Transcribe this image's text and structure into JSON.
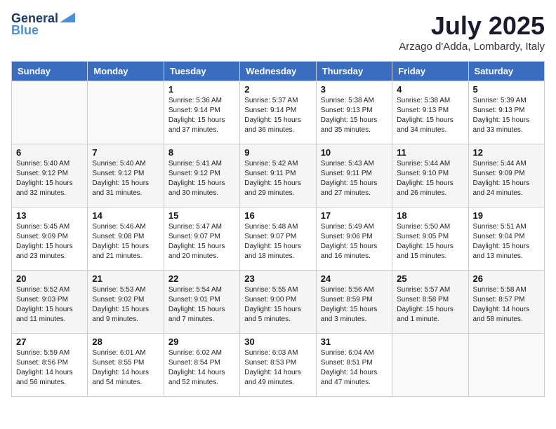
{
  "header": {
    "logo_line1": "General",
    "logo_line2": "Blue",
    "month": "July 2025",
    "location": "Arzago d'Adda, Lombardy, Italy"
  },
  "weekdays": [
    "Sunday",
    "Monday",
    "Tuesday",
    "Wednesday",
    "Thursday",
    "Friday",
    "Saturday"
  ],
  "weeks": [
    [
      {
        "day": "",
        "info": ""
      },
      {
        "day": "",
        "info": ""
      },
      {
        "day": "1",
        "info": "Sunrise: 5:36 AM\nSunset: 9:14 PM\nDaylight: 15 hours\nand 37 minutes."
      },
      {
        "day": "2",
        "info": "Sunrise: 5:37 AM\nSunset: 9:14 PM\nDaylight: 15 hours\nand 36 minutes."
      },
      {
        "day": "3",
        "info": "Sunrise: 5:38 AM\nSunset: 9:13 PM\nDaylight: 15 hours\nand 35 minutes."
      },
      {
        "day": "4",
        "info": "Sunrise: 5:38 AM\nSunset: 9:13 PM\nDaylight: 15 hours\nand 34 minutes."
      },
      {
        "day": "5",
        "info": "Sunrise: 5:39 AM\nSunset: 9:13 PM\nDaylight: 15 hours\nand 33 minutes."
      }
    ],
    [
      {
        "day": "6",
        "info": "Sunrise: 5:40 AM\nSunset: 9:12 PM\nDaylight: 15 hours\nand 32 minutes."
      },
      {
        "day": "7",
        "info": "Sunrise: 5:40 AM\nSunset: 9:12 PM\nDaylight: 15 hours\nand 31 minutes."
      },
      {
        "day": "8",
        "info": "Sunrise: 5:41 AM\nSunset: 9:12 PM\nDaylight: 15 hours\nand 30 minutes."
      },
      {
        "day": "9",
        "info": "Sunrise: 5:42 AM\nSunset: 9:11 PM\nDaylight: 15 hours\nand 29 minutes."
      },
      {
        "day": "10",
        "info": "Sunrise: 5:43 AM\nSunset: 9:11 PM\nDaylight: 15 hours\nand 27 minutes."
      },
      {
        "day": "11",
        "info": "Sunrise: 5:44 AM\nSunset: 9:10 PM\nDaylight: 15 hours\nand 26 minutes."
      },
      {
        "day": "12",
        "info": "Sunrise: 5:44 AM\nSunset: 9:09 PM\nDaylight: 15 hours\nand 24 minutes."
      }
    ],
    [
      {
        "day": "13",
        "info": "Sunrise: 5:45 AM\nSunset: 9:09 PM\nDaylight: 15 hours\nand 23 minutes."
      },
      {
        "day": "14",
        "info": "Sunrise: 5:46 AM\nSunset: 9:08 PM\nDaylight: 15 hours\nand 21 minutes."
      },
      {
        "day": "15",
        "info": "Sunrise: 5:47 AM\nSunset: 9:07 PM\nDaylight: 15 hours\nand 20 minutes."
      },
      {
        "day": "16",
        "info": "Sunrise: 5:48 AM\nSunset: 9:07 PM\nDaylight: 15 hours\nand 18 minutes."
      },
      {
        "day": "17",
        "info": "Sunrise: 5:49 AM\nSunset: 9:06 PM\nDaylight: 15 hours\nand 16 minutes."
      },
      {
        "day": "18",
        "info": "Sunrise: 5:50 AM\nSunset: 9:05 PM\nDaylight: 15 hours\nand 15 minutes."
      },
      {
        "day": "19",
        "info": "Sunrise: 5:51 AM\nSunset: 9:04 PM\nDaylight: 15 hours\nand 13 minutes."
      }
    ],
    [
      {
        "day": "20",
        "info": "Sunrise: 5:52 AM\nSunset: 9:03 PM\nDaylight: 15 hours\nand 11 minutes."
      },
      {
        "day": "21",
        "info": "Sunrise: 5:53 AM\nSunset: 9:02 PM\nDaylight: 15 hours\nand 9 minutes."
      },
      {
        "day": "22",
        "info": "Sunrise: 5:54 AM\nSunset: 9:01 PM\nDaylight: 15 hours\nand 7 minutes."
      },
      {
        "day": "23",
        "info": "Sunrise: 5:55 AM\nSunset: 9:00 PM\nDaylight: 15 hours\nand 5 minutes."
      },
      {
        "day": "24",
        "info": "Sunrise: 5:56 AM\nSunset: 8:59 PM\nDaylight: 15 hours\nand 3 minutes."
      },
      {
        "day": "25",
        "info": "Sunrise: 5:57 AM\nSunset: 8:58 PM\nDaylight: 15 hours\nand 1 minute."
      },
      {
        "day": "26",
        "info": "Sunrise: 5:58 AM\nSunset: 8:57 PM\nDaylight: 14 hours\nand 58 minutes."
      }
    ],
    [
      {
        "day": "27",
        "info": "Sunrise: 5:59 AM\nSunset: 8:56 PM\nDaylight: 14 hours\nand 56 minutes."
      },
      {
        "day": "28",
        "info": "Sunrise: 6:01 AM\nSunset: 8:55 PM\nDaylight: 14 hours\nand 54 minutes."
      },
      {
        "day": "29",
        "info": "Sunrise: 6:02 AM\nSunset: 8:54 PM\nDaylight: 14 hours\nand 52 minutes."
      },
      {
        "day": "30",
        "info": "Sunrise: 6:03 AM\nSunset: 8:53 PM\nDaylight: 14 hours\nand 49 minutes."
      },
      {
        "day": "31",
        "info": "Sunrise: 6:04 AM\nSunset: 8:51 PM\nDaylight: 14 hours\nand 47 minutes."
      },
      {
        "day": "",
        "info": ""
      },
      {
        "day": "",
        "info": ""
      }
    ]
  ]
}
